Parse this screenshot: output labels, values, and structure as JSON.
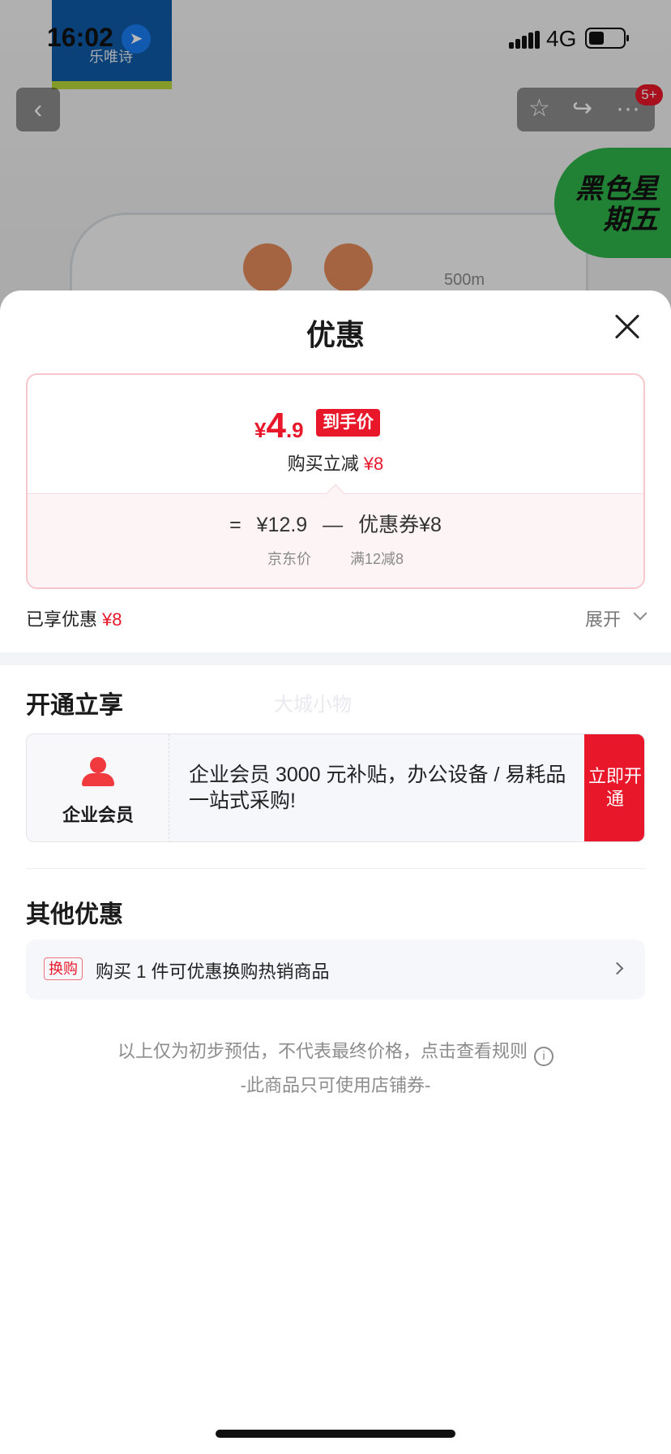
{
  "status_bar": {
    "time": "16:02",
    "network": "4G"
  },
  "background": {
    "brand_text": "乐唯诗",
    "product_capacity_mark": "500m",
    "promo_badge": "黑色星期五",
    "cart_badge": "5+"
  },
  "sheet": {
    "title": "优惠",
    "price_card": {
      "final_price_symbol": "¥",
      "final_price_int": "4",
      "final_price_dec": ".9",
      "final_price_tag": "到手价",
      "instant_reduce_label": "购买立减",
      "instant_reduce_value": "¥8",
      "equals": "=",
      "jd_price": "¥12.9",
      "minus": "—",
      "coupon": "优惠券¥8",
      "jd_price_label": "京东价",
      "coupon_rule": "满12减8"
    },
    "enjoyed": {
      "label": "已享优惠",
      "value": "¥8",
      "expand_label": "展开"
    },
    "member_section": {
      "title": "开通立享",
      "watermark": "大城小物",
      "member_name": "企业会员",
      "description": "企业会员 3000 元补贴，办公设备 / 易耗品一站式采购!",
      "open_button": "立即开通"
    },
    "other_section": {
      "title": "其他优惠",
      "exchange_tag": "换购",
      "exchange_text": "购买 1 件可优惠换购热销商品"
    },
    "notes": {
      "line1": "以上仅为初步预估，不代表最终价格，点击查看规则",
      "line2": "-此商品只可使用店铺券-"
    }
  },
  "colors": {
    "accent_red": "#e9172a",
    "sheet_bg": "#ffffff",
    "card_border": "#f8c7cd"
  }
}
